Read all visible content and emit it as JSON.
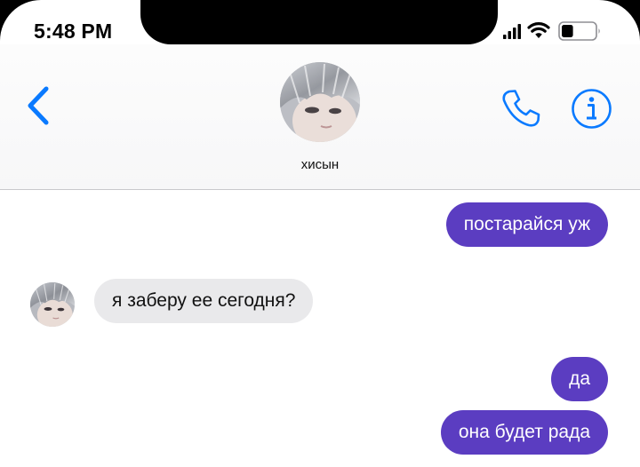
{
  "status_bar": {
    "time": "5:48 PM",
    "icons": [
      "signal-icon",
      "wifi-icon",
      "battery-icon"
    ],
    "battery_level": 0.35
  },
  "header": {
    "contact_name": "хисын",
    "icons": [
      "back-chevron-icon",
      "phone-icon",
      "info-icon"
    ],
    "accent_color": "#0a7aff"
  },
  "messages": [
    {
      "direction": "outgoing",
      "text": "постарайся уж"
    },
    {
      "direction": "incoming",
      "text": "я заберу ее сегодня?"
    },
    {
      "direction": "outgoing",
      "text": "да"
    },
    {
      "direction": "outgoing",
      "text": "она будет рада"
    }
  ],
  "colors": {
    "outgoing_bubble": "#5b3dc1",
    "incoming_bubble": "#e9e9eb"
  }
}
